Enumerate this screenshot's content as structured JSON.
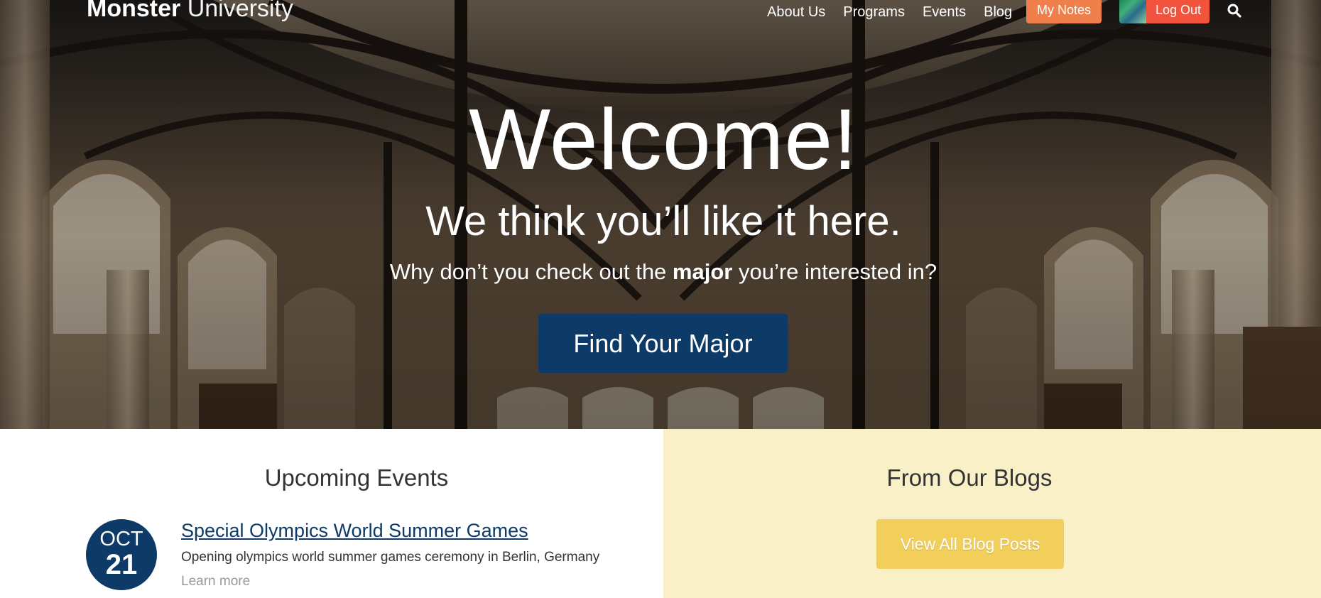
{
  "header": {
    "brand_bold": "Monster",
    "brand_light": "University",
    "nav": [
      "About Us",
      "Programs",
      "Events",
      "Blog"
    ],
    "my_notes_label": "My Notes",
    "logout_label": "Log Out"
  },
  "hero": {
    "heading": "Welcome!",
    "tagline": "We think you’ll like it here.",
    "prompt_before": "Why don’t you check out the",
    "prompt_bold": "major",
    "prompt_after": "you’re interested in?",
    "cta_label": "Find Your Major"
  },
  "events": {
    "title": "Upcoming Events",
    "items": [
      {
        "month": "OCT",
        "day": "21",
        "title": "Special Olympics World Summer Games",
        "description": "Opening olympics world summer games ceremony in Berlin, Germany",
        "more_label": "Learn more"
      }
    ]
  },
  "blogs": {
    "title": "From Our Blogs",
    "view_all_label": "View All Blog Posts"
  },
  "colors": {
    "primary_navy": "#0d3a66",
    "notes_orange": "#f0804b",
    "logout_red": "#f2533d",
    "blog_panel": "#faf0c8",
    "blog_button": "#f2cf5b"
  }
}
